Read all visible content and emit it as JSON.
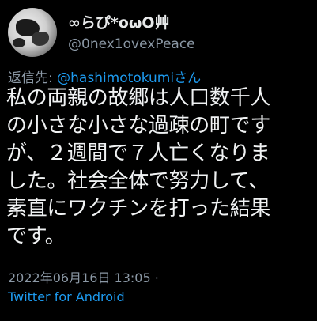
{
  "author": {
    "display_name": "∞らぴ*oωO艸",
    "handle": "@0nex1ovexPeace",
    "avatar_icon": "profile-avatar"
  },
  "reply": {
    "prefix": "返信先: ",
    "mention": "@hashimotokumi",
    "suffix": "さん"
  },
  "tweet": {
    "text": "私の両親の故郷は人口数千人\nの小さな小さな過疎の町です\nが、２週間で７人亡くなりま\nした。社会全体で努力して、\n素直にワクチンを打った結果\nです。"
  },
  "meta": {
    "timestamp": "2022年06月16日 13:05 ·",
    "source": "Twitter for Android"
  },
  "colors": {
    "background": "#000000",
    "text": "#e7e9ea",
    "secondary": "#8b98a5",
    "link": "#1d9bf0"
  }
}
